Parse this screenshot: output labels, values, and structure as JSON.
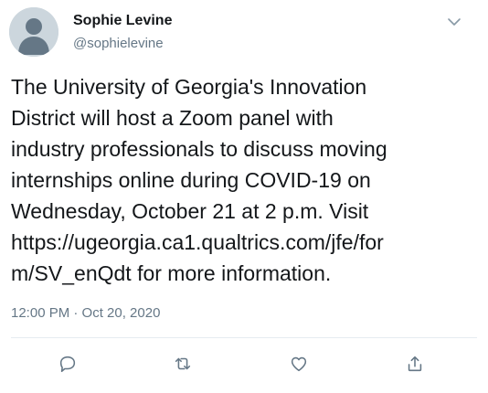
{
  "author": {
    "name": "Sophie Levine",
    "handle": "@sophielevine"
  },
  "tweet": {
    "lines": [
      "The University of Georgia's Innovation",
      "District will host a Zoom panel with",
      "industry professionals to discuss moving",
      "internships online during COVID-19 on",
      "Wednesday, October 21 at 2 p.m. Visit",
      "https://ugeorgia.ca1.qualtrics.com/jfe/for",
      "m/SV_enQdt for more information."
    ],
    "timestamp": "12:00 PM · Oct 20, 2020"
  },
  "icons": {
    "menu": "chevron-down-icon",
    "reply": "reply-icon",
    "retweet": "retweet-icon",
    "like": "heart-icon",
    "share": "share-icon"
  },
  "colors": {
    "text": "#14171a",
    "secondary": "#657786",
    "divider": "#e6ecf0",
    "avatar_bg": "#ccd6dd"
  }
}
